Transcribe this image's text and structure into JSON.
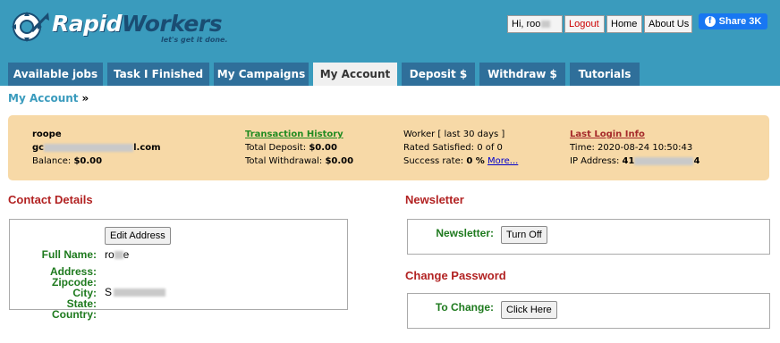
{
  "brand": {
    "name_part1": "Rapid",
    "name_part2": "Workers",
    "tagline": "let's get it done."
  },
  "topbar": {
    "hi_label": "Hi, roo",
    "logout": "Logout",
    "home": "Home",
    "about": "About Us",
    "share": "Share 3K"
  },
  "tabs": [
    "Available jobs",
    "Task I Finished",
    "My Campaigns",
    "My Account",
    "Deposit $",
    "Withdraw $",
    "Tutorials"
  ],
  "active_tab": "My Account",
  "breadcrumb": {
    "label": "My Account",
    "arrow": "»"
  },
  "account": {
    "username": "roope",
    "email_start": "gc",
    "email_end": "l.com",
    "balance_label": "Balance:",
    "balance_value": "$0.00"
  },
  "transactions": {
    "title": "Transaction History",
    "deposit_label": "Total Deposit:",
    "deposit_value": "$0.00",
    "withdrawal_label": "Total Withdrawal:",
    "withdrawal_value": "$0.00"
  },
  "worker": {
    "line1": "Worker [ last 30 days ]",
    "rated_label": "Rated Satisfied: 0 of 0",
    "success_label": "Success rate:",
    "success_value": "0 %",
    "more": "More..."
  },
  "login": {
    "title": "Last Login Info",
    "time_label": "Time:",
    "time_value": "2020-08-24 10:50:43",
    "ip_label": "IP Address:",
    "ip_start": "41",
    "ip_end": "4"
  },
  "contact": {
    "title": "Contact Details",
    "edit_button": "Edit Address",
    "full_name_label": "Full Name:",
    "full_name_start": "ro",
    "full_name_end": "e",
    "address_label": "Address:",
    "zipcode_label": "Zipcode:",
    "city_label": "City:",
    "city_start": "S",
    "state_label": "State:",
    "country_label": "Country:"
  },
  "newsletter": {
    "title": "Newsletter",
    "label": "Newsletter:",
    "button": "Turn Off"
  },
  "password": {
    "title": "Change Password",
    "label": "To Change:",
    "button": "Click Here"
  },
  "colors": {
    "header": "#3a9bbd",
    "tab": "#2f6f9a",
    "info_bar": "#f7d9a7",
    "section_title": "#b22222",
    "field_label": "#1e7a1e"
  }
}
